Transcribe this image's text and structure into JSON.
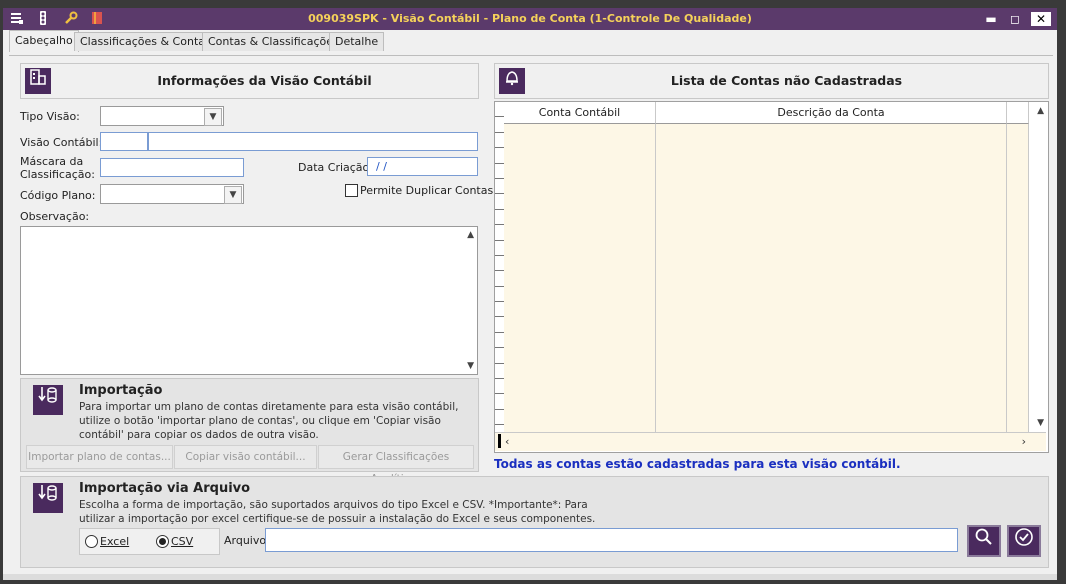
{
  "window": {
    "title": "009039SPK - Visão Contábil - Plano de Conta (1-Controle De Qualidade)",
    "minimize_glyph": "▬",
    "maximize_glyph": "◻",
    "close_glyph": "✕"
  },
  "titlebar_icons": [
    {
      "name": "menu-icon",
      "glyph": "☰"
    },
    {
      "name": "traffic-light-icon",
      "glyph": "⚑"
    },
    {
      "name": "wrench-icon",
      "glyph": "🔧"
    },
    {
      "name": "book-icon",
      "glyph": "📕"
    }
  ],
  "tabs": [
    {
      "label": "Cabeçalho"
    },
    {
      "label": "Classificações & Contas"
    },
    {
      "label": "Contas & Classificações"
    },
    {
      "label": "Detalhe"
    }
  ],
  "info_panel": {
    "title": "Informações da Visão Contábil",
    "tipo_visao_label": "Tipo Visão:",
    "visao_contabil_label": "Visão Contábil:",
    "mascara_label_1": "Máscara da",
    "mascara_label_2": "Classificação:",
    "data_criacao_label": "Data Criação:",
    "data_criacao_value": "/ /",
    "codigo_plano_label": "Código Plano:",
    "permite_duplicar_label": "Permite Duplicar Contas",
    "observacao_label": "Observação:"
  },
  "importacao": {
    "title": "Importação",
    "text": "Para importar um plano de contas diretamente para esta visão contábil, utilize o botão 'importar plano de contas', ou clique em 'Copiar visão contábil' para copiar os dados de outra visão.",
    "btn_importar": "Importar plano de contas...",
    "btn_copiar": "Copiar visão contábil...",
    "btn_gerar": "Gerar Classificações Analíticas"
  },
  "lista_panel": {
    "title": "Lista de Contas não Cadastradas",
    "col_conta": "Conta Contábil",
    "col_descricao": "Descrição da Conta",
    "notice": "Todas as contas estão cadastradas para esta visão contábil."
  },
  "arquivo": {
    "title": "Importação via Arquivo",
    "text": "Escolha a forma de importação, são suportados arquivos do tipo Excel e CSV. *Importante*: Para utilizar a importação por excel certifique-se de possuir a instalação do Excel e seus componentes.",
    "excel_label": "Excel",
    "csv_label": "CSV",
    "selected": "CSV",
    "arquivo_label": "Arquivo"
  }
}
